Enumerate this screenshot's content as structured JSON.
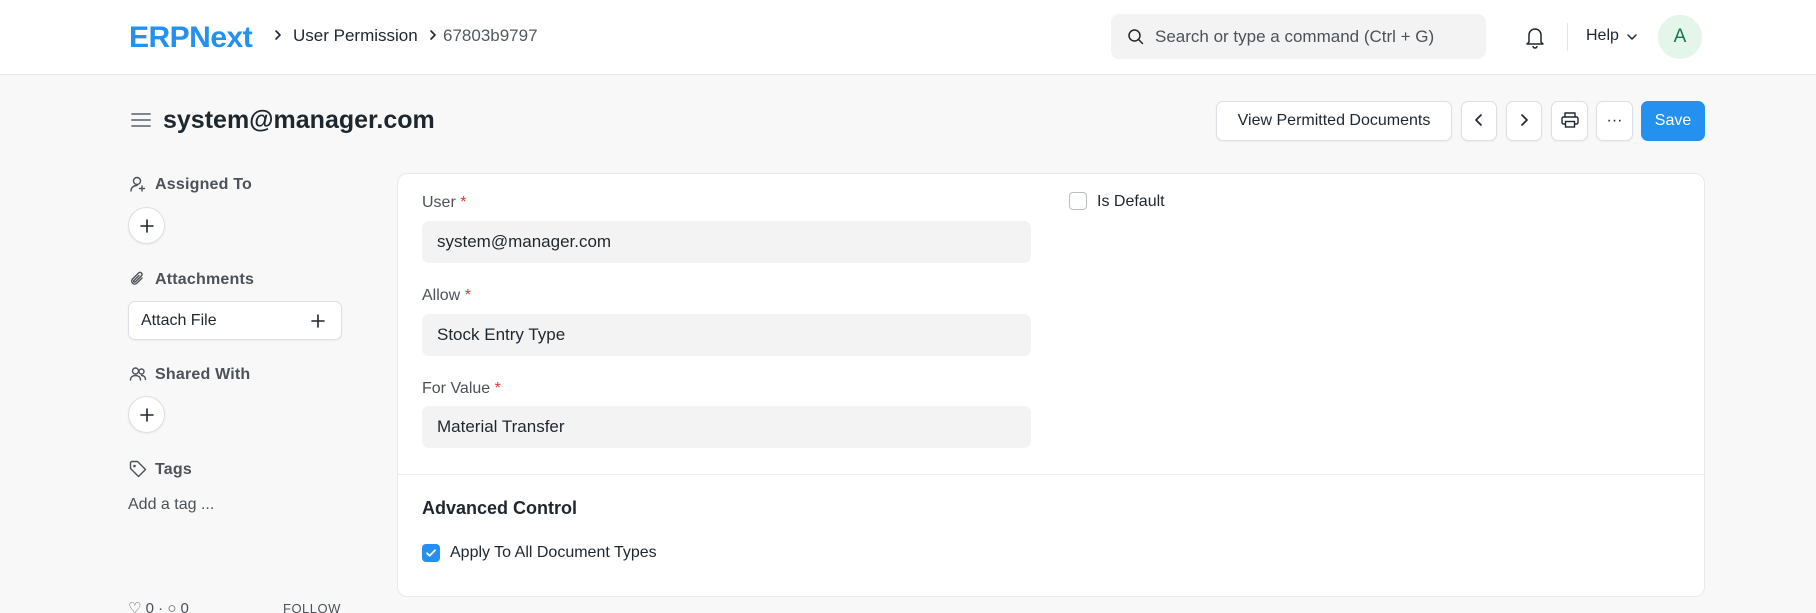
{
  "navbar": {
    "logo": "ERPNext",
    "breadcrumbs": [
      "User Permission",
      "67803b9797"
    ],
    "search_placeholder": "Search or type a command (Ctrl + G)",
    "help_label": "Help",
    "avatar_initial": "A"
  },
  "page": {
    "title": "system@manager.com",
    "view_docs_label": "View Permitted Documents",
    "more_label": "···",
    "save_label": "Save"
  },
  "sidebar": {
    "assigned_to": "Assigned To",
    "attachments": "Attachments",
    "attach_file": "Attach File",
    "shared_with": "Shared With",
    "tags": "Tags",
    "add_tag": "Add a tag ...",
    "likes": "0",
    "comments": "0",
    "follow": "FOLLOW"
  },
  "form": {
    "user_label": "User",
    "user_value": "system@manager.com",
    "allow_label": "Allow",
    "allow_value": "Stock Entry Type",
    "for_value_label": "For Value",
    "for_value_value": "Material Transfer",
    "is_default_label": "Is Default",
    "is_default_checked": false,
    "advanced_title": "Advanced Control",
    "apply_all_label": "Apply To All Document Types",
    "apply_all_checked": true
  },
  "colors": {
    "primary": "#2490ef",
    "required": "#e03636"
  }
}
